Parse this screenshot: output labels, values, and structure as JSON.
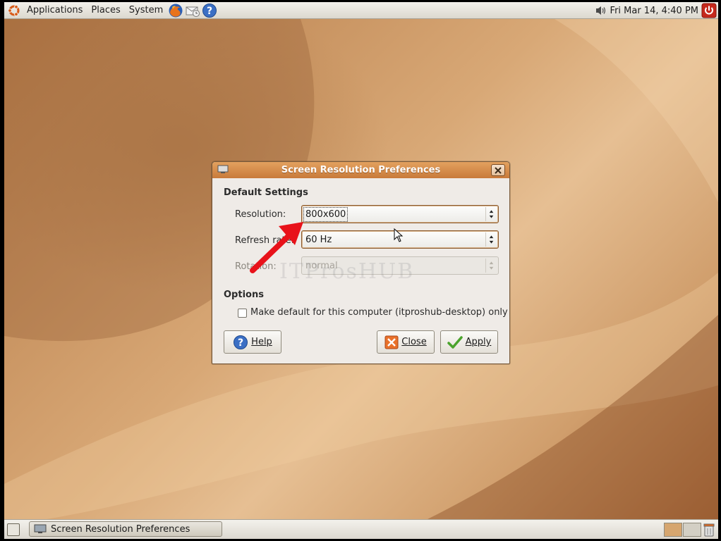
{
  "top_panel": {
    "menus": [
      "Applications",
      "Places",
      "System"
    ],
    "launchers": [
      "firefox-icon",
      "mail-icon",
      "help-icon"
    ],
    "clock": "Fri Mar 14,  4:40 PM"
  },
  "dialog": {
    "title": "Screen Resolution Preferences",
    "default_settings_heading": "Default Settings",
    "resolution_label": "Resolution:",
    "resolution_value": "800x600",
    "refresh_label": "Refresh rate:",
    "refresh_value": "60 Hz",
    "rotation_label": "Rotation:",
    "rotation_value": "normal",
    "options_heading": "Options",
    "checkbox_label": "Make default for this computer (itproshub-desktop) only",
    "checkbox_checked": false,
    "help_button": "Help",
    "close_button": "Close",
    "apply_button": "Apply"
  },
  "watermark": "ITProsHUB",
  "taskbar": {
    "task_label": "Screen Resolution Preferences"
  },
  "colors": {
    "titlebar": "#d88c48",
    "annotation_arrow": "#e8121a",
    "panel": "#e8e5dd"
  }
}
